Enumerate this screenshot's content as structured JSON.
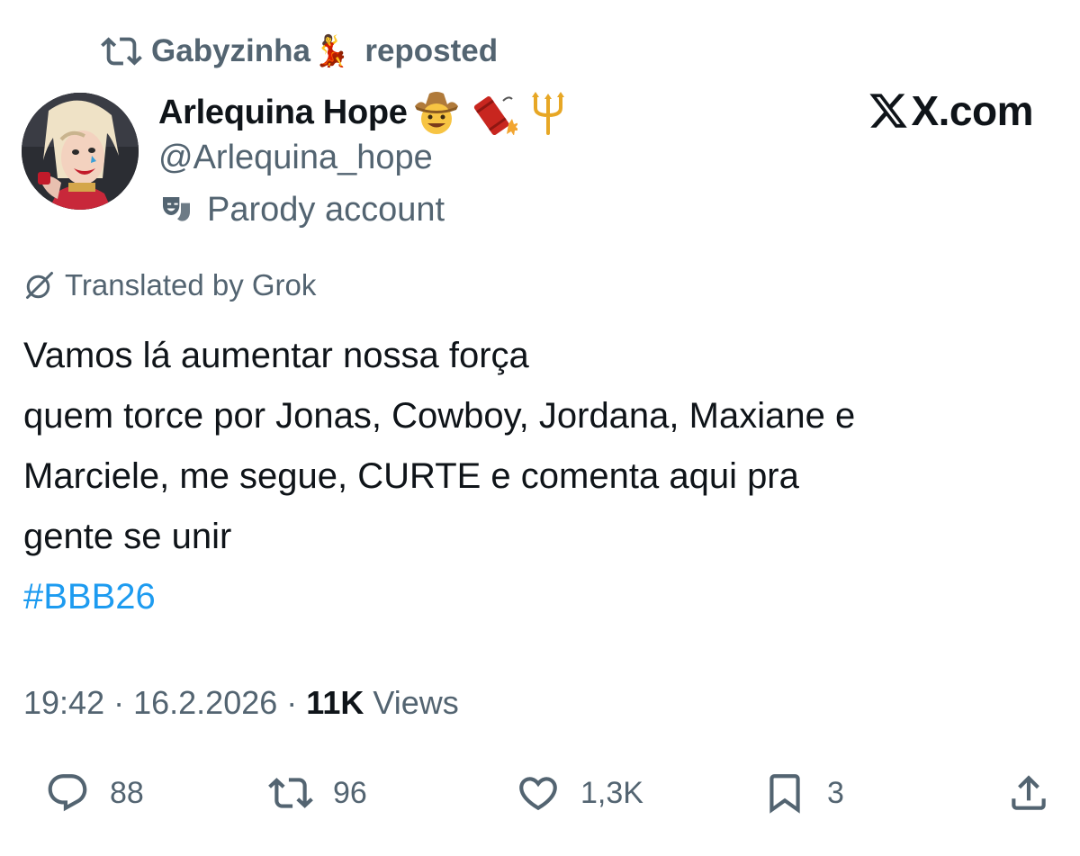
{
  "repost": {
    "icon": "repost-icon",
    "user": "Gabyzinha",
    "emoji": "💃",
    "suffix": "reposted"
  },
  "author": {
    "display_name": "Arlequina Hope",
    "badges": [
      "cowboy-emoji",
      "firecracker-emoji",
      "trident-emoji"
    ],
    "handle": "@Arlequina_hope",
    "label": "Parody account"
  },
  "watermark": "X.com",
  "translation_note": "Translated by Grok",
  "tweet": {
    "lines": [
      "Vamos lá aumentar nossa força",
      "quem torce por Jonas, Cowboy, Jordana, Maxiane e",
      "Marciele, me segue, CURTE e comenta aqui pra",
      "gente se unir"
    ],
    "hashtag": "#BBB26"
  },
  "meta": {
    "time": "19:42",
    "date": "16.2.2026",
    "views_count": "11K",
    "views_label": "Views"
  },
  "actions": {
    "replies": "88",
    "reposts": "96",
    "likes": "1,3K",
    "bookmarks": "3"
  },
  "colors": {
    "hashtag": "#1d9bf0",
    "secondary_text": "#536471",
    "primary_text": "#0f1419"
  }
}
